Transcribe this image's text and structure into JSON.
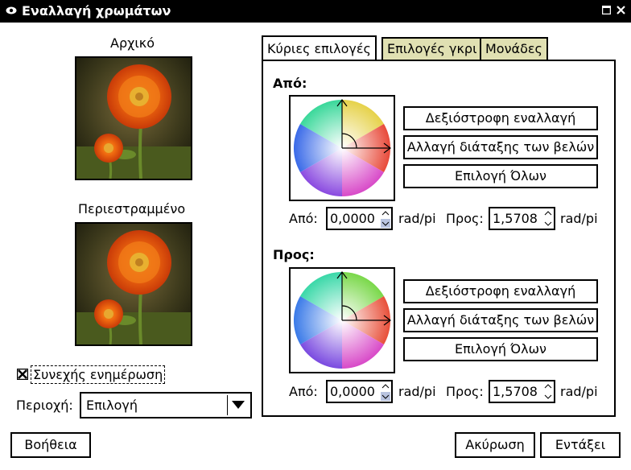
{
  "window": {
    "title": "Εναλλαγή χρωμάτων"
  },
  "preview": {
    "original_label": "Αρχικό",
    "rotated_label": "Περιεστραμμένο",
    "continuous_update_label": "Συνεχής ενημέρωση",
    "continuous_update_checked": true,
    "area_label": "Περιοχή:",
    "area_value": "Επιλογή"
  },
  "tabs": [
    {
      "label": "Κύριες επιλογές",
      "active": true
    },
    {
      "label": "Επιλογές γκρι",
      "active": false
    },
    {
      "label": "Μονάδες",
      "active": false
    }
  ],
  "from_section": {
    "heading": "Από:",
    "clockwise_label": "Δεξιόστροφη εναλλαγή",
    "swap_arrows_label": "Αλλαγή διάταξης των βελών",
    "select_all_label": "Επιλογή Όλων",
    "from_label": "Από:",
    "from_value": "0,0000",
    "to_label": "Προς:",
    "to_value": "1,5708",
    "unit1": "rad/pi",
    "unit2": "rad/pi"
  },
  "to_section": {
    "heading": "Προς:",
    "clockwise_label": "Δεξιόστροφη εναλλαγή",
    "swap_arrows_label": "Αλλαγή διάταξης των βελών",
    "select_all_label": "Επιλογή Όλων",
    "from_label": "Από:",
    "from_value": "0,0000",
    "to_label": "Προς:",
    "to_value": "1,5708",
    "unit1": "rad/pi",
    "unit2": "rad/pi"
  },
  "buttons": {
    "help": "Βοήθεια",
    "cancel": "Ακύρωση",
    "ok": "Εντάξει"
  },
  "icons": [
    "eye-menu-icon",
    "maximize-icon",
    "close-icon",
    "checkbox-icon",
    "dropdown-arrow-icon",
    "spin-arrows-icon"
  ]
}
